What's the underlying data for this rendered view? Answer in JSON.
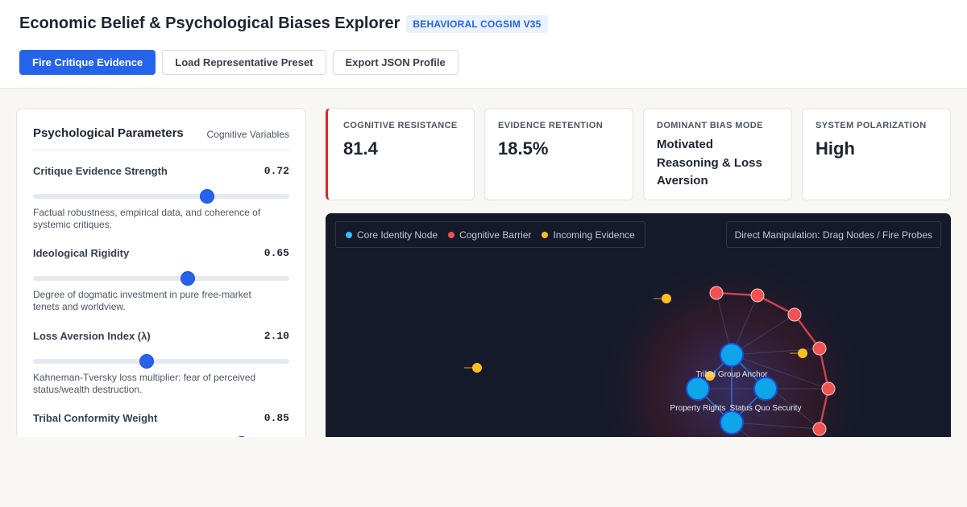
{
  "header": {
    "title": "Economic Belief & Psychological Biases Explorer",
    "badge": "BEHAVIORAL COGSIM V35",
    "buttons": {
      "fire": "Fire Critique Evidence",
      "load": "Load Representative Preset",
      "export": "Export JSON Profile"
    }
  },
  "panel": {
    "title": "Psychological Parameters",
    "subtitle": "Cognitive Variables",
    "params": [
      {
        "label": "Critique Evidence Strength",
        "value": "0.72",
        "fraction": 0.678,
        "desc": "Factual robustness, empirical data, and coherence of systemic critiques."
      },
      {
        "label": "Ideological Rigidity",
        "value": "0.65",
        "fraction": 0.604,
        "desc": "Degree of dogmatic investment in pure free-market tenets and worldview."
      },
      {
        "label": "Loss Aversion Index (λ)",
        "value": "2.10",
        "fraction": 0.444,
        "desc": "Kahneman-Tversky loss multiplier: fear of perceived status/wealth destruction."
      },
      {
        "label": "Tribal Conformity Weight",
        "value": "0.85",
        "fraction": 0.814,
        "desc": ""
      }
    ]
  },
  "stats": [
    {
      "label": "COGNITIVE RESISTANCE",
      "value": "81.4"
    },
    {
      "label": "EVIDENCE RETENTION",
      "value": "18.5%"
    },
    {
      "label": "DOMINANT BIAS MODE",
      "value": "Motivated Reasoning & Loss Aversion"
    },
    {
      "label": "SYSTEM POLARIZATION",
      "value": "High"
    }
  ],
  "viz": {
    "legend": {
      "core": "Core Identity Node",
      "barrier": "Cognitive Barrier",
      "evidence": "Incoming Evidence"
    },
    "hint": "Direct Manipulation: Drag Nodes / Fire Probes",
    "node_labels": {
      "tribal": "Tribal Group Anchor",
      "property": "Property Rights",
      "status": "Status Quo Security"
    },
    "colors": {
      "core": "#38bdf8",
      "barrier": "#f05252",
      "evidence": "#fbbf24",
      "background": "#141a2a"
    }
  }
}
